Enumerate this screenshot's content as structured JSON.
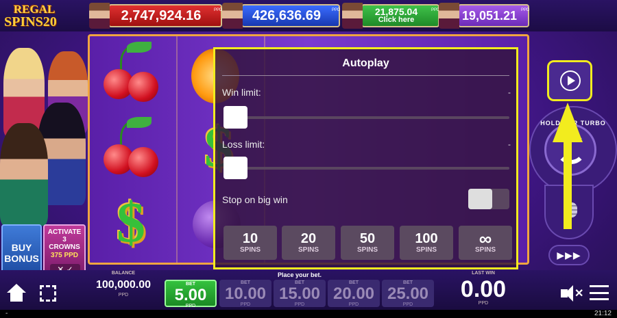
{
  "logo": {
    "line1": "REGAL",
    "line2": "SPINS20"
  },
  "jackpots": [
    {
      "amount": "2,747,924.16",
      "unit": "PPD"
    },
    {
      "amount": "426,636.69",
      "unit": "PPD"
    },
    {
      "amount": "21,875.04",
      "sub": "Click here",
      "unit": "PPD"
    },
    {
      "amount": "19,051.21",
      "unit": "PPD"
    }
  ],
  "buy_bonus": {
    "line1": "BUY",
    "line2": "BONUS"
  },
  "activate": {
    "line1": "ACTIVATE",
    "line2": "3",
    "line3": "CROWNS",
    "line4": "375 PPD",
    "controls": "✕ ✓"
  },
  "autoplay": {
    "title": "Autoplay",
    "win_limit_label": "Win limit:",
    "win_limit_value": "-",
    "loss_limit_label": "Loss limit:",
    "loss_limit_value": "-",
    "stop_big_win_label": "Stop on big win",
    "spin_options": [
      {
        "count": "10",
        "unit": "SPINS"
      },
      {
        "count": "20",
        "unit": "SPINS"
      },
      {
        "count": "50",
        "unit": "SPINS"
      },
      {
        "count": "100",
        "unit": "SPINS"
      },
      {
        "count": "∞",
        "unit": "SPINS"
      }
    ]
  },
  "right_panel": {
    "hold_text": "HOLD FOR TURBO SPIN",
    "turbo_label": "▶▶▶"
  },
  "bottom": {
    "balance_label": "BALANCE",
    "balance_value": "100,000.00",
    "balance_unit": "PPD",
    "place_bet": "Place your bet.",
    "bets": [
      {
        "label": "BET",
        "value": "5.00",
        "unit": "PPD",
        "selected": true
      },
      {
        "label": "BET",
        "value": "10.00",
        "unit": "PPD",
        "selected": false
      },
      {
        "label": "BET",
        "value": "15.00",
        "unit": "PPD",
        "selected": false
      },
      {
        "label": "BET",
        "value": "20.00",
        "unit": "PPD",
        "selected": false
      },
      {
        "label": "BET",
        "value": "25.00",
        "unit": "PPD",
        "selected": false
      }
    ],
    "last_win_label": "LAST WIN",
    "last_win_value": "0.00",
    "last_win_unit": "PPD"
  },
  "status": {
    "left": "-",
    "clock": "21:12"
  }
}
